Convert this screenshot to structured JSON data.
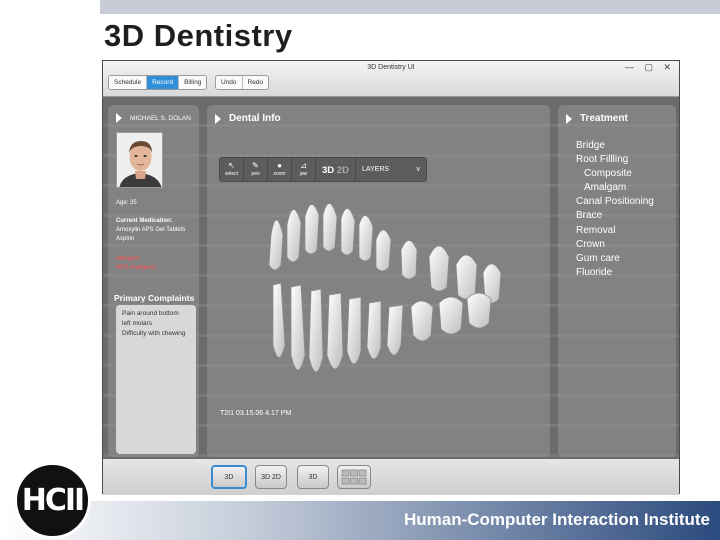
{
  "slide": {
    "title": "3D Dentistry",
    "footer": "Human-Computer Interaction Institute",
    "logo_text": "HCII"
  },
  "window": {
    "title": "3D Dentistry UI",
    "nav_tabs": [
      "Schedule",
      "Record",
      "Billing"
    ],
    "active_tab": "Record",
    "edit_buttons": [
      "Undo",
      "Redo"
    ],
    "controls": "— ▢ ✕"
  },
  "patient": {
    "name": "MICHAEL S. DOLAN",
    "age_label": "Age:",
    "age_value": "35",
    "medication_label": "Current Medication:",
    "medications": [
      "Amoxylin APS Gel Tablets",
      "Aspirin"
    ],
    "allergies_label": "Allergies:",
    "allergies_value": "HPS Analgesic",
    "complaints_title": "Primary Complaints",
    "complaints": [
      "Pain around bottom",
      "left molars",
      "Difficulty with chewing"
    ]
  },
  "dental": {
    "title": "Dental Info",
    "tools": [
      {
        "icon": "cursor-icon",
        "glyph": "↖",
        "label": "select"
      },
      {
        "icon": "pen-icon",
        "glyph": "✎",
        "label": "pen"
      },
      {
        "icon": "zoom-icon",
        "glyph": "●",
        "label": "zoom"
      },
      {
        "icon": "jaw-icon",
        "glyph": "⊿",
        "label": "jaw"
      }
    ],
    "mode_active": "3D",
    "mode_inactive": "2D",
    "layers_label": "LAYERS",
    "layers_chevron": "v",
    "timestamp": "T2I1  03.15.06  4.17 PM"
  },
  "treatment": {
    "title": "Treatment",
    "items": [
      "Bridge",
      "Root Fillling",
      "Composite",
      "Amalgam",
      "Canal Positioning",
      "Brace",
      "Removal",
      "Crown",
      "Gum care",
      "Fluoride"
    ],
    "indented": [
      "Composite",
      "Amalgam"
    ]
  },
  "view_buttons": [
    "3D",
    "3D 2D",
    "3D",
    ""
  ],
  "colors": {
    "accent": "#2f8fd8",
    "allergy": "#ff4a4a",
    "footer_dark": "#2b4a7d"
  }
}
